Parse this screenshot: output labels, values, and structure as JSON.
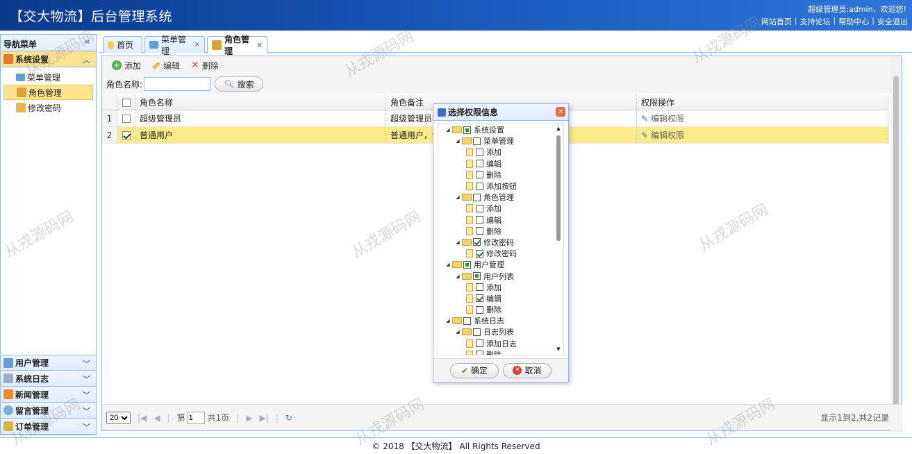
{
  "header": {
    "title": "【交大物流】后台管理系统",
    "user_text": "超级管理员:admin，欢迎您!",
    "links": [
      "网站首页",
      "支持论坛",
      "帮助中心",
      "安全退出"
    ]
  },
  "sidebar": {
    "title": "导航菜单",
    "active_section": "系统设置",
    "items": [
      "菜单管理",
      "角色管理",
      "修改密码"
    ],
    "other_sections": [
      "用户管理",
      "系统日志",
      "新闻管理",
      "留言管理",
      "订单管理"
    ]
  },
  "tabs": [
    "首页",
    "菜单管理",
    "角色管理"
  ],
  "toolbar": {
    "add": "添加",
    "edit": "编辑",
    "delete": "删除"
  },
  "search": {
    "label": "角色名称:",
    "button": "搜索"
  },
  "grid": {
    "headers": [
      "角色名称",
      "角色备注",
      "权限操作"
    ],
    "rows": [
      {
        "no": "1",
        "name": "超级管理员",
        "remark": "超级管理员拥",
        "action": "编辑权限",
        "checked": false
      },
      {
        "no": "2",
        "name": "普通用户",
        "remark": "普通用户，请",
        "action": "编辑权限",
        "checked": true
      }
    ]
  },
  "pager": {
    "page_size": "20",
    "page_label": "第",
    "page": "1",
    "total_pages": "共1页",
    "info": "显示1到2,共2记录"
  },
  "dialog": {
    "title": "选择权限信息",
    "ok": "确定",
    "cancel": "取消",
    "tree": [
      {
        "label": "系统设置",
        "level": 0,
        "state": "part",
        "type": "folder"
      },
      {
        "label": "菜单管理",
        "level": 1,
        "state": "off",
        "type": "folder"
      },
      {
        "label": "添加",
        "level": 2,
        "state": "off",
        "type": "file"
      },
      {
        "label": "编辑",
        "level": 2,
        "state": "off",
        "type": "file"
      },
      {
        "label": "删除",
        "level": 2,
        "state": "off",
        "type": "file"
      },
      {
        "label": "添加按钮",
        "level": 2,
        "state": "off",
        "type": "file"
      },
      {
        "label": "角色管理",
        "level": 1,
        "state": "off",
        "type": "folder"
      },
      {
        "label": "添加",
        "level": 2,
        "state": "off",
        "type": "file"
      },
      {
        "label": "编辑",
        "level": 2,
        "state": "off",
        "type": "file"
      },
      {
        "label": "删除",
        "level": 2,
        "state": "off",
        "type": "file"
      },
      {
        "label": "修改密码",
        "level": 1,
        "state": "on",
        "type": "folder"
      },
      {
        "label": "修改密码",
        "level": 2,
        "state": "on",
        "type": "file"
      },
      {
        "label": "用户管理",
        "level": 0,
        "state": "part",
        "type": "folder"
      },
      {
        "label": "用户列表",
        "level": 1,
        "state": "part",
        "type": "folder"
      },
      {
        "label": "添加",
        "level": 2,
        "state": "off",
        "type": "file"
      },
      {
        "label": "编辑",
        "level": 2,
        "state": "on",
        "type": "file"
      },
      {
        "label": "删除",
        "level": 2,
        "state": "off",
        "type": "file"
      },
      {
        "label": "系统日志",
        "level": 0,
        "state": "off",
        "type": "folder"
      },
      {
        "label": "日志列表",
        "level": 1,
        "state": "off",
        "type": "folder"
      },
      {
        "label": "添加日志",
        "level": 2,
        "state": "off",
        "type": "file"
      },
      {
        "label": "删除",
        "level": 2,
        "state": "off",
        "type": "file"
      }
    ]
  },
  "footer": "© 2018 【交大物流】 All Rights Reserved",
  "watermark": "从戎源码网"
}
